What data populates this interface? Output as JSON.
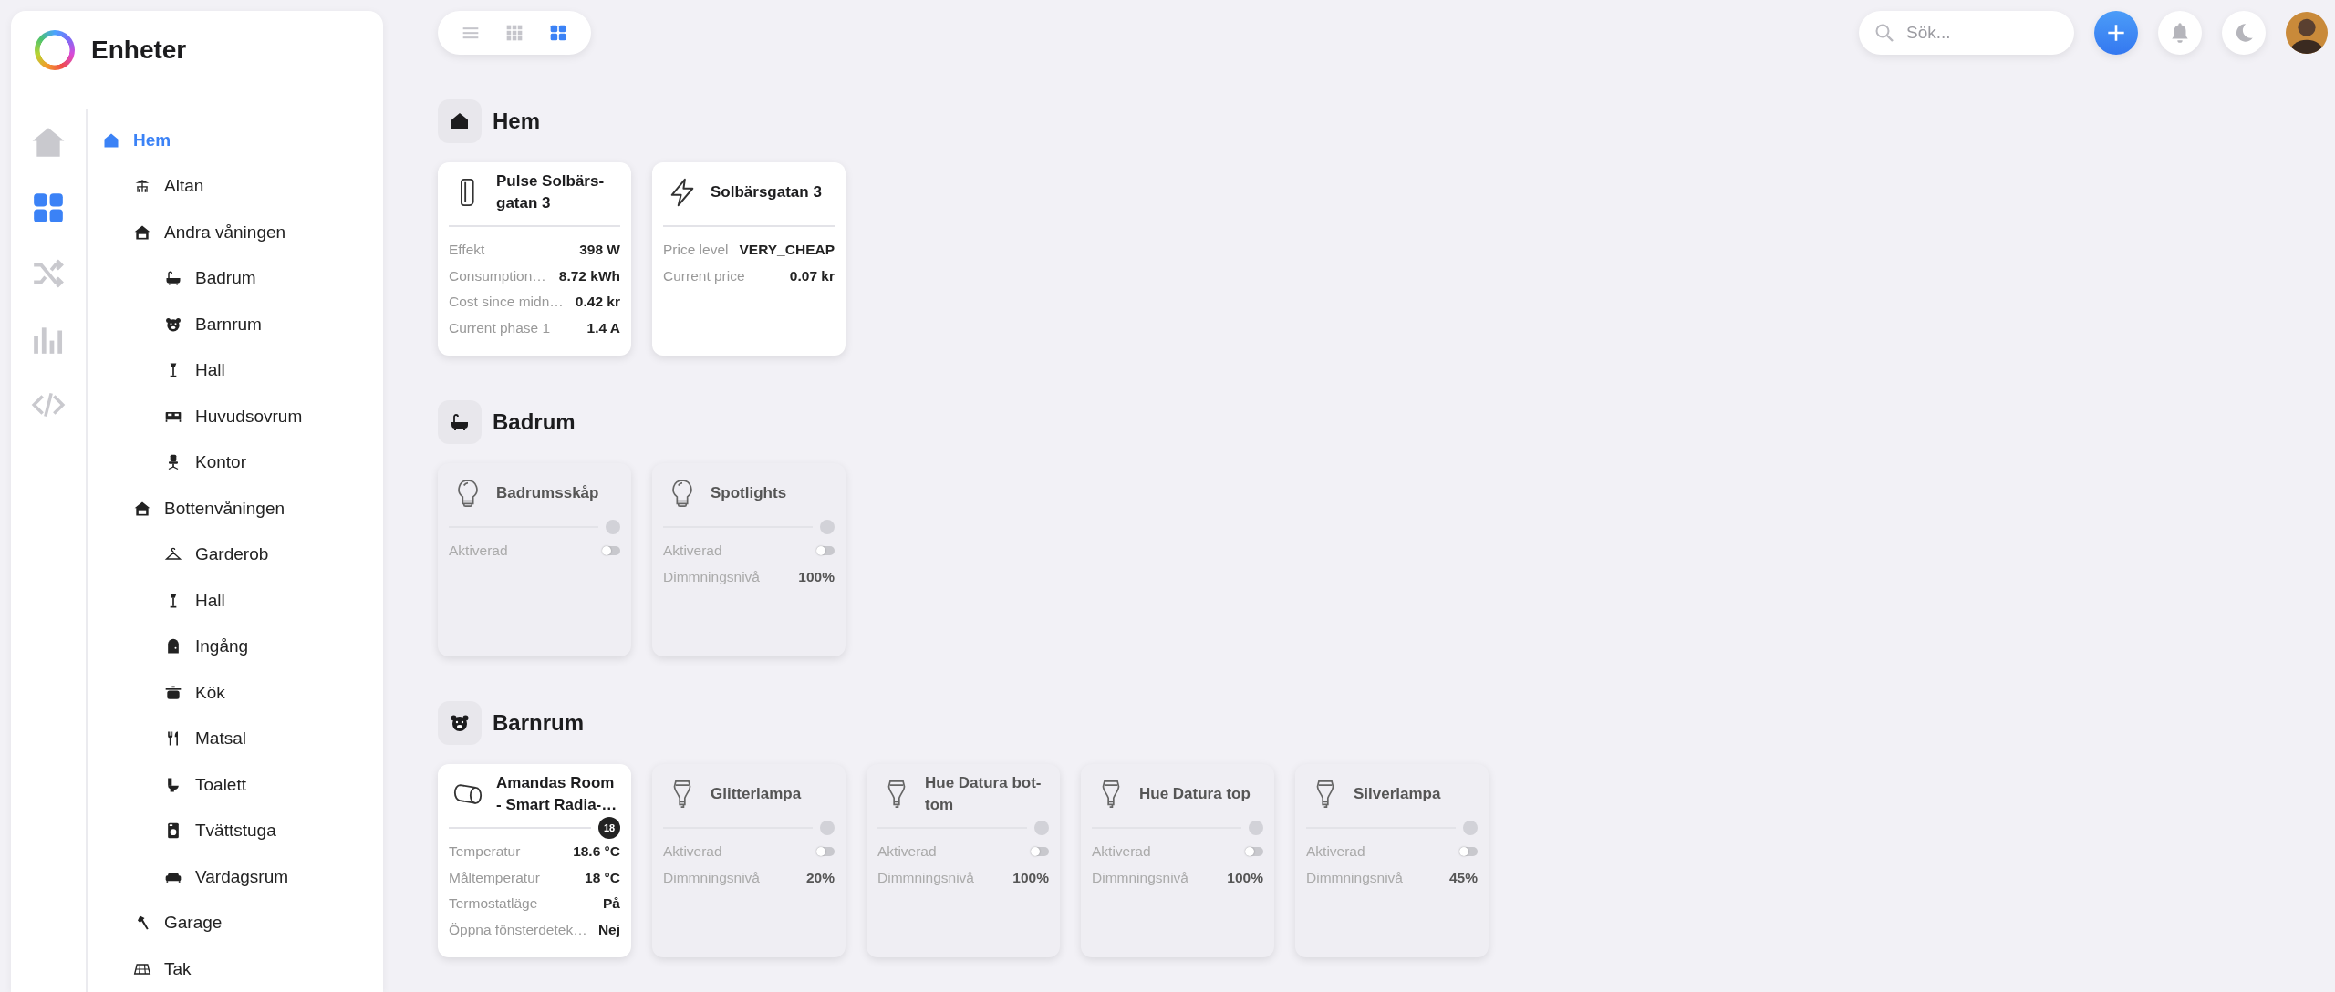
{
  "app": {
    "title": "Enheter"
  },
  "rail": [
    {
      "kind": "home",
      "selected": false
    },
    {
      "kind": "grid",
      "selected": true
    },
    {
      "kind": "shuffle",
      "selected": false
    },
    {
      "kind": "bars",
      "selected": false
    },
    {
      "kind": "code",
      "selected": false
    }
  ],
  "tree": [
    {
      "label": "Hem",
      "kind": "house",
      "selected": true,
      "children": [
        {
          "label": "Altan",
          "kind": "patio",
          "selected": false
        },
        {
          "label": "Andra våningen",
          "kind": "floor",
          "selected": false,
          "children": [
            {
              "label": "Badrum",
              "kind": "bath",
              "selected": false
            },
            {
              "label": "Barnrum",
              "kind": "bear",
              "selected": false
            },
            {
              "label": "Hall",
              "kind": "lamp",
              "selected": false
            },
            {
              "label": "Huvudsovrum",
              "kind": "bed",
              "selected": false
            },
            {
              "label": "Kontor",
              "kind": "chair",
              "selected": false
            }
          ]
        },
        {
          "label": "Bottenvåningen",
          "kind": "floor",
          "selected": false,
          "children": [
            {
              "label": "Garderob",
              "kind": "hanger",
              "selected": false
            },
            {
              "label": "Hall",
              "kind": "lamp",
              "selected": false
            },
            {
              "label": "Ingång",
              "kind": "door",
              "selected": false
            },
            {
              "label": "Kök",
              "kind": "pot",
              "selected": false
            },
            {
              "label": "Matsal",
              "kind": "cutlery",
              "selected": false
            },
            {
              "label": "Toalett",
              "kind": "toilet",
              "selected": false
            },
            {
              "label": "Tvättstuga",
              "kind": "washer",
              "selected": false
            },
            {
              "label": "Vardagsrum",
              "kind": "sofa",
              "selected": false
            }
          ]
        },
        {
          "label": "Garage",
          "kind": "hammer",
          "selected": false
        },
        {
          "label": "Tak",
          "kind": "roof",
          "selected": false
        }
      ]
    }
  ],
  "view_modes": [
    {
      "kind": "list",
      "selected": false
    },
    {
      "kind": "small-grid",
      "selected": false
    },
    {
      "kind": "grid",
      "selected": true
    }
  ],
  "search": {
    "placeholder": "Sök..."
  },
  "sections": [
    {
      "title": "Hem",
      "kind": "house",
      "devices": [
        {
          "kind": "meter",
          "name": "Pulse Solbärs-gatan 3",
          "on": true,
          "rows": [
            {
              "kind": "text",
              "label": "Effekt",
              "value": "398 W"
            },
            {
              "kind": "text",
              "label": "Consumption…",
              "value": "8.72 kWh"
            },
            {
              "kind": "text",
              "label": "Cost since midn…",
              "value": "0.42 kr"
            },
            {
              "kind": "text",
              "label": "Current phase 1",
              "value": "1.4 A"
            }
          ]
        },
        {
          "kind": "bolt",
          "name": "Solbärsgatan 3",
          "on": true,
          "rows": [
            {
              "kind": "text",
              "label": "Price level",
              "value": "VERY_CHEAP"
            },
            {
              "kind": "text",
              "label": "Current price",
              "value": "0.07 kr"
            }
          ]
        }
      ]
    },
    {
      "title": "Badrum",
      "kind": "bath",
      "devices": [
        {
          "kind": "bulb",
          "name": "Badrumsskåp",
          "on": false,
          "rows": [
            {
              "kind": "toggle",
              "label": "Aktiverad",
              "checked": false
            }
          ]
        },
        {
          "kind": "bulb",
          "name": "Spotlights",
          "on": false,
          "rows": [
            {
              "kind": "toggle",
              "label": "Aktiverad",
              "checked": false
            },
            {
              "kind": "text",
              "label": "Dimmningsnivå",
              "value": "100%"
            }
          ]
        }
      ]
    },
    {
      "title": "Barnrum",
      "kind": "bear",
      "devices": [
        {
          "kind": "radiator",
          "name": "Amandas Room - Smart Radia-…",
          "on": true,
          "badge": "18",
          "rows": [
            {
              "kind": "text",
              "label": "Temperatur",
              "value": "18.6 °C"
            },
            {
              "kind": "text",
              "label": "Måltemperatur",
              "value": "18 °C"
            },
            {
              "kind": "text",
              "label": "Termostatläge",
              "value": "På"
            },
            {
              "kind": "text",
              "label": "Öppna fönsterdetek…",
              "value": "Nej"
            }
          ]
        },
        {
          "kind": "hue",
          "name": "Glitterlampa",
          "on": false,
          "rows": [
            {
              "kind": "toggle",
              "label": "Aktiverad",
              "checked": false
            },
            {
              "kind": "text",
              "label": "Dimmningsnivå",
              "value": "20%"
            }
          ]
        },
        {
          "kind": "hue",
          "name": "Hue Datura bot-tom",
          "on": false,
          "rows": [
            {
              "kind": "toggle",
              "label": "Aktiverad",
              "checked": false
            },
            {
              "kind": "text",
              "label": "Dimmningsnivå",
              "value": "100%"
            }
          ]
        },
        {
          "kind": "hue",
          "name": "Hue Datura top",
          "on": false,
          "rows": [
            {
              "kind": "toggle",
              "label": "Aktiverad",
              "checked": false
            },
            {
              "kind": "text",
              "label": "Dimmningsnivå",
              "value": "100%"
            }
          ]
        },
        {
          "kind": "hue",
          "name": "Silverlampa",
          "on": false,
          "rows": [
            {
              "kind": "toggle",
              "label": "Aktiverad",
              "checked": false
            },
            {
              "kind": "text",
              "label": "Dimmningsnivå",
              "value": "45%"
            }
          ]
        }
      ]
    }
  ]
}
